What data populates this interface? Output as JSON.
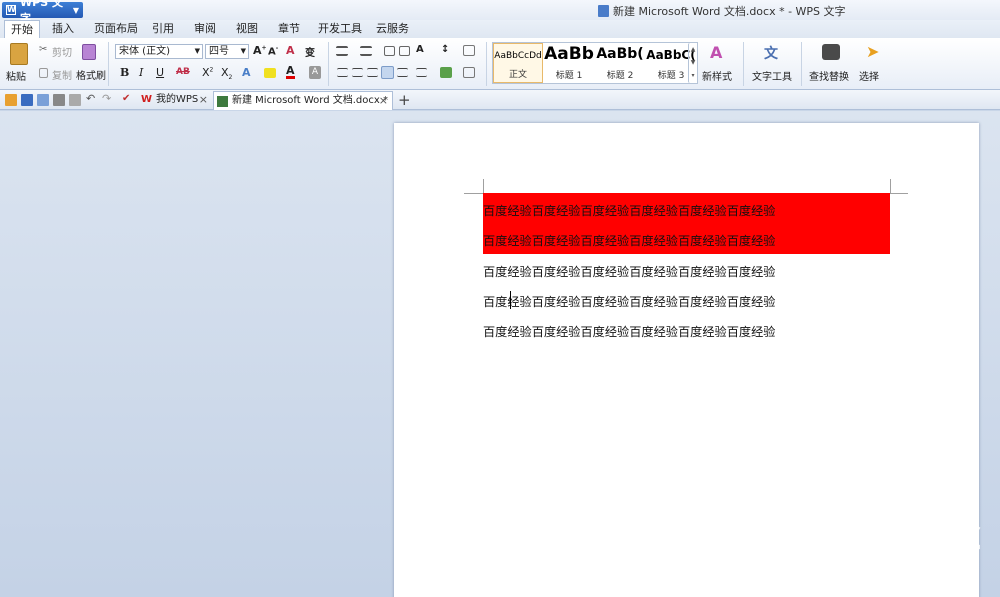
{
  "titlebar": {
    "app_button": "WPS 文字",
    "window_title": "新建 Microsoft Word 文档.docx * - WPS 文字"
  },
  "menu": {
    "tabs": [
      "开始",
      "插入",
      "页面布局",
      "引用",
      "审阅",
      "视图",
      "章节",
      "开发工具",
      "云服务"
    ],
    "active": "开始"
  },
  "ribbon": {
    "paste": "粘贴",
    "cut": "剪切",
    "copy": "复制",
    "format_painter": "格式刷",
    "font_name": "宋体 (正文)",
    "font_size": "四号",
    "styles": [
      {
        "sample": "AaBbCcDd",
        "name": "正文"
      },
      {
        "sample": "AaBb",
        "name": "标题 1"
      },
      {
        "sample": "AaBb(",
        "name": "标题 2"
      },
      {
        "sample": "AaBbC(",
        "name": "标题 3"
      }
    ],
    "new_style": "新样式",
    "text_tools": "文字工具",
    "find_replace": "查找替换",
    "select": "选择"
  },
  "doc_tabs": [
    {
      "label": "我的WPS",
      "active": false
    },
    {
      "label": "新建 Microsoft Word 文档.docx *",
      "active": true
    }
  ],
  "document": {
    "lines": [
      "百度经验百度经验百度经验百度经验百度经验百度经验",
      "百度经验百度经验百度经验百度经验百度经验百度经验",
      "百度经验百度经验百度经验百度经验百度经验百度经验",
      "百度经验百度经验百度经验百度经验百度经验百度经验",
      "百度经验百度经验百度经验百度经验百度经验百度经验"
    ],
    "highlight_color": "#ff0000"
  },
  "watermark": {
    "brand": "Bai du 经验",
    "url": "jingyan.baidu.com"
  },
  "colors": {
    "accent": "#2f6cc8",
    "workspace": "#c9d6e8"
  }
}
